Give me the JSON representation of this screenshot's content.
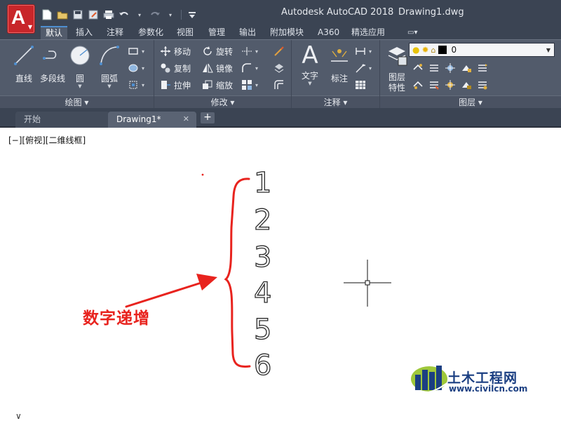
{
  "app": {
    "logo_letter": "A",
    "name": "Autodesk AutoCAD 2018",
    "document": "Drawing1.dwg"
  },
  "ribbon_tabs": [
    "默认",
    "插入",
    "注释",
    "参数化",
    "视图",
    "管理",
    "输出",
    "附加模块",
    "A360",
    "精选应用"
  ],
  "ribbon": {
    "draw": {
      "line": "直线",
      "polyline": "多段线",
      "circle": "圆",
      "arc": "圆弧",
      "panel_title": "绘图"
    },
    "modify": {
      "move": "移动",
      "rotate": "旋转",
      "copy": "复制",
      "mirror": "镜像",
      "stretch": "拉伸",
      "scale": "缩放",
      "panel_title": "修改"
    },
    "annotation": {
      "text": "文字",
      "dimension": "标注",
      "panel_title": "注释"
    },
    "layers": {
      "properties": "图层\n特性",
      "properties_line1": "图层",
      "properties_line2": "特性",
      "current_layer": "0",
      "panel_title": "图层"
    }
  },
  "doc_tabs": {
    "start": "开始",
    "drawing": "Drawing1*"
  },
  "viewport": {
    "label": "[−][俯视][二维线框]"
  },
  "drawing": {
    "numbers": [
      "1",
      "2",
      "3",
      "4",
      "5",
      "6"
    ]
  },
  "annotation": {
    "text": "数字递增",
    "color": "#e8231e"
  },
  "watermark": {
    "name": "土木工程网",
    "url": "www.civilcn.com"
  },
  "colors": {
    "titlebar": "#3b4453",
    "ribbon": "#525b6b",
    "accent": "#4f8fd0",
    "app_button": "#c8262a"
  }
}
